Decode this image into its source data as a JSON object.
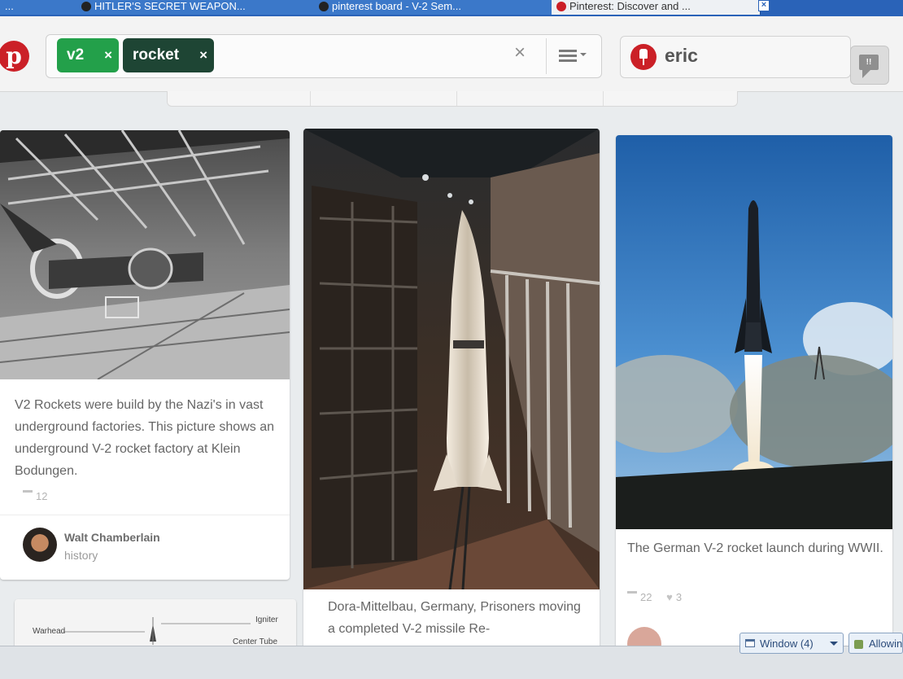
{
  "browser": {
    "tabs": [
      {
        "title": "..."
      },
      {
        "title": "HITLER'S SECRET WEAPON..."
      },
      {
        "title": "pinterest board - V-2 Sem..."
      },
      {
        "title": "Pinterest: Discover and ..."
      }
    ],
    "tab_close_glyph": "×"
  },
  "header": {
    "logo_glyph": "p",
    "search": {
      "chips": [
        {
          "label": "v2",
          "color": "#23a04a"
        },
        {
          "label": "rocket",
          "color": "#1e4534"
        }
      ],
      "chip_close_glyph": "×",
      "clear_glyph": "×"
    },
    "user": {
      "name": "eric"
    },
    "notifications_glyph": "!!",
    "brand_color": "#cb2027"
  },
  "pins": [
    {
      "description": "V2 Rockets were build by the Nazi's in vast underground factories. This picture shows an underground V-2 rocket factory at Klein Bodungen.",
      "repins": "12",
      "pinner": {
        "name": "Walt Chamberlain",
        "board": "history"
      }
    },
    {
      "description": "Dora-Mittelbau, Germany, Prisoners moving a completed V-2 missile Re-"
    },
    {
      "description": "The German V-2 rocket launch during WWII.",
      "repins": "22",
      "likes": "3"
    },
    {
      "diagram_labels": [
        "Warhead",
        "Igniter",
        "Center Tube"
      ]
    }
  ],
  "bottom_bar": {
    "window_button": "Window (4)",
    "allowing_button": "Allowin"
  }
}
